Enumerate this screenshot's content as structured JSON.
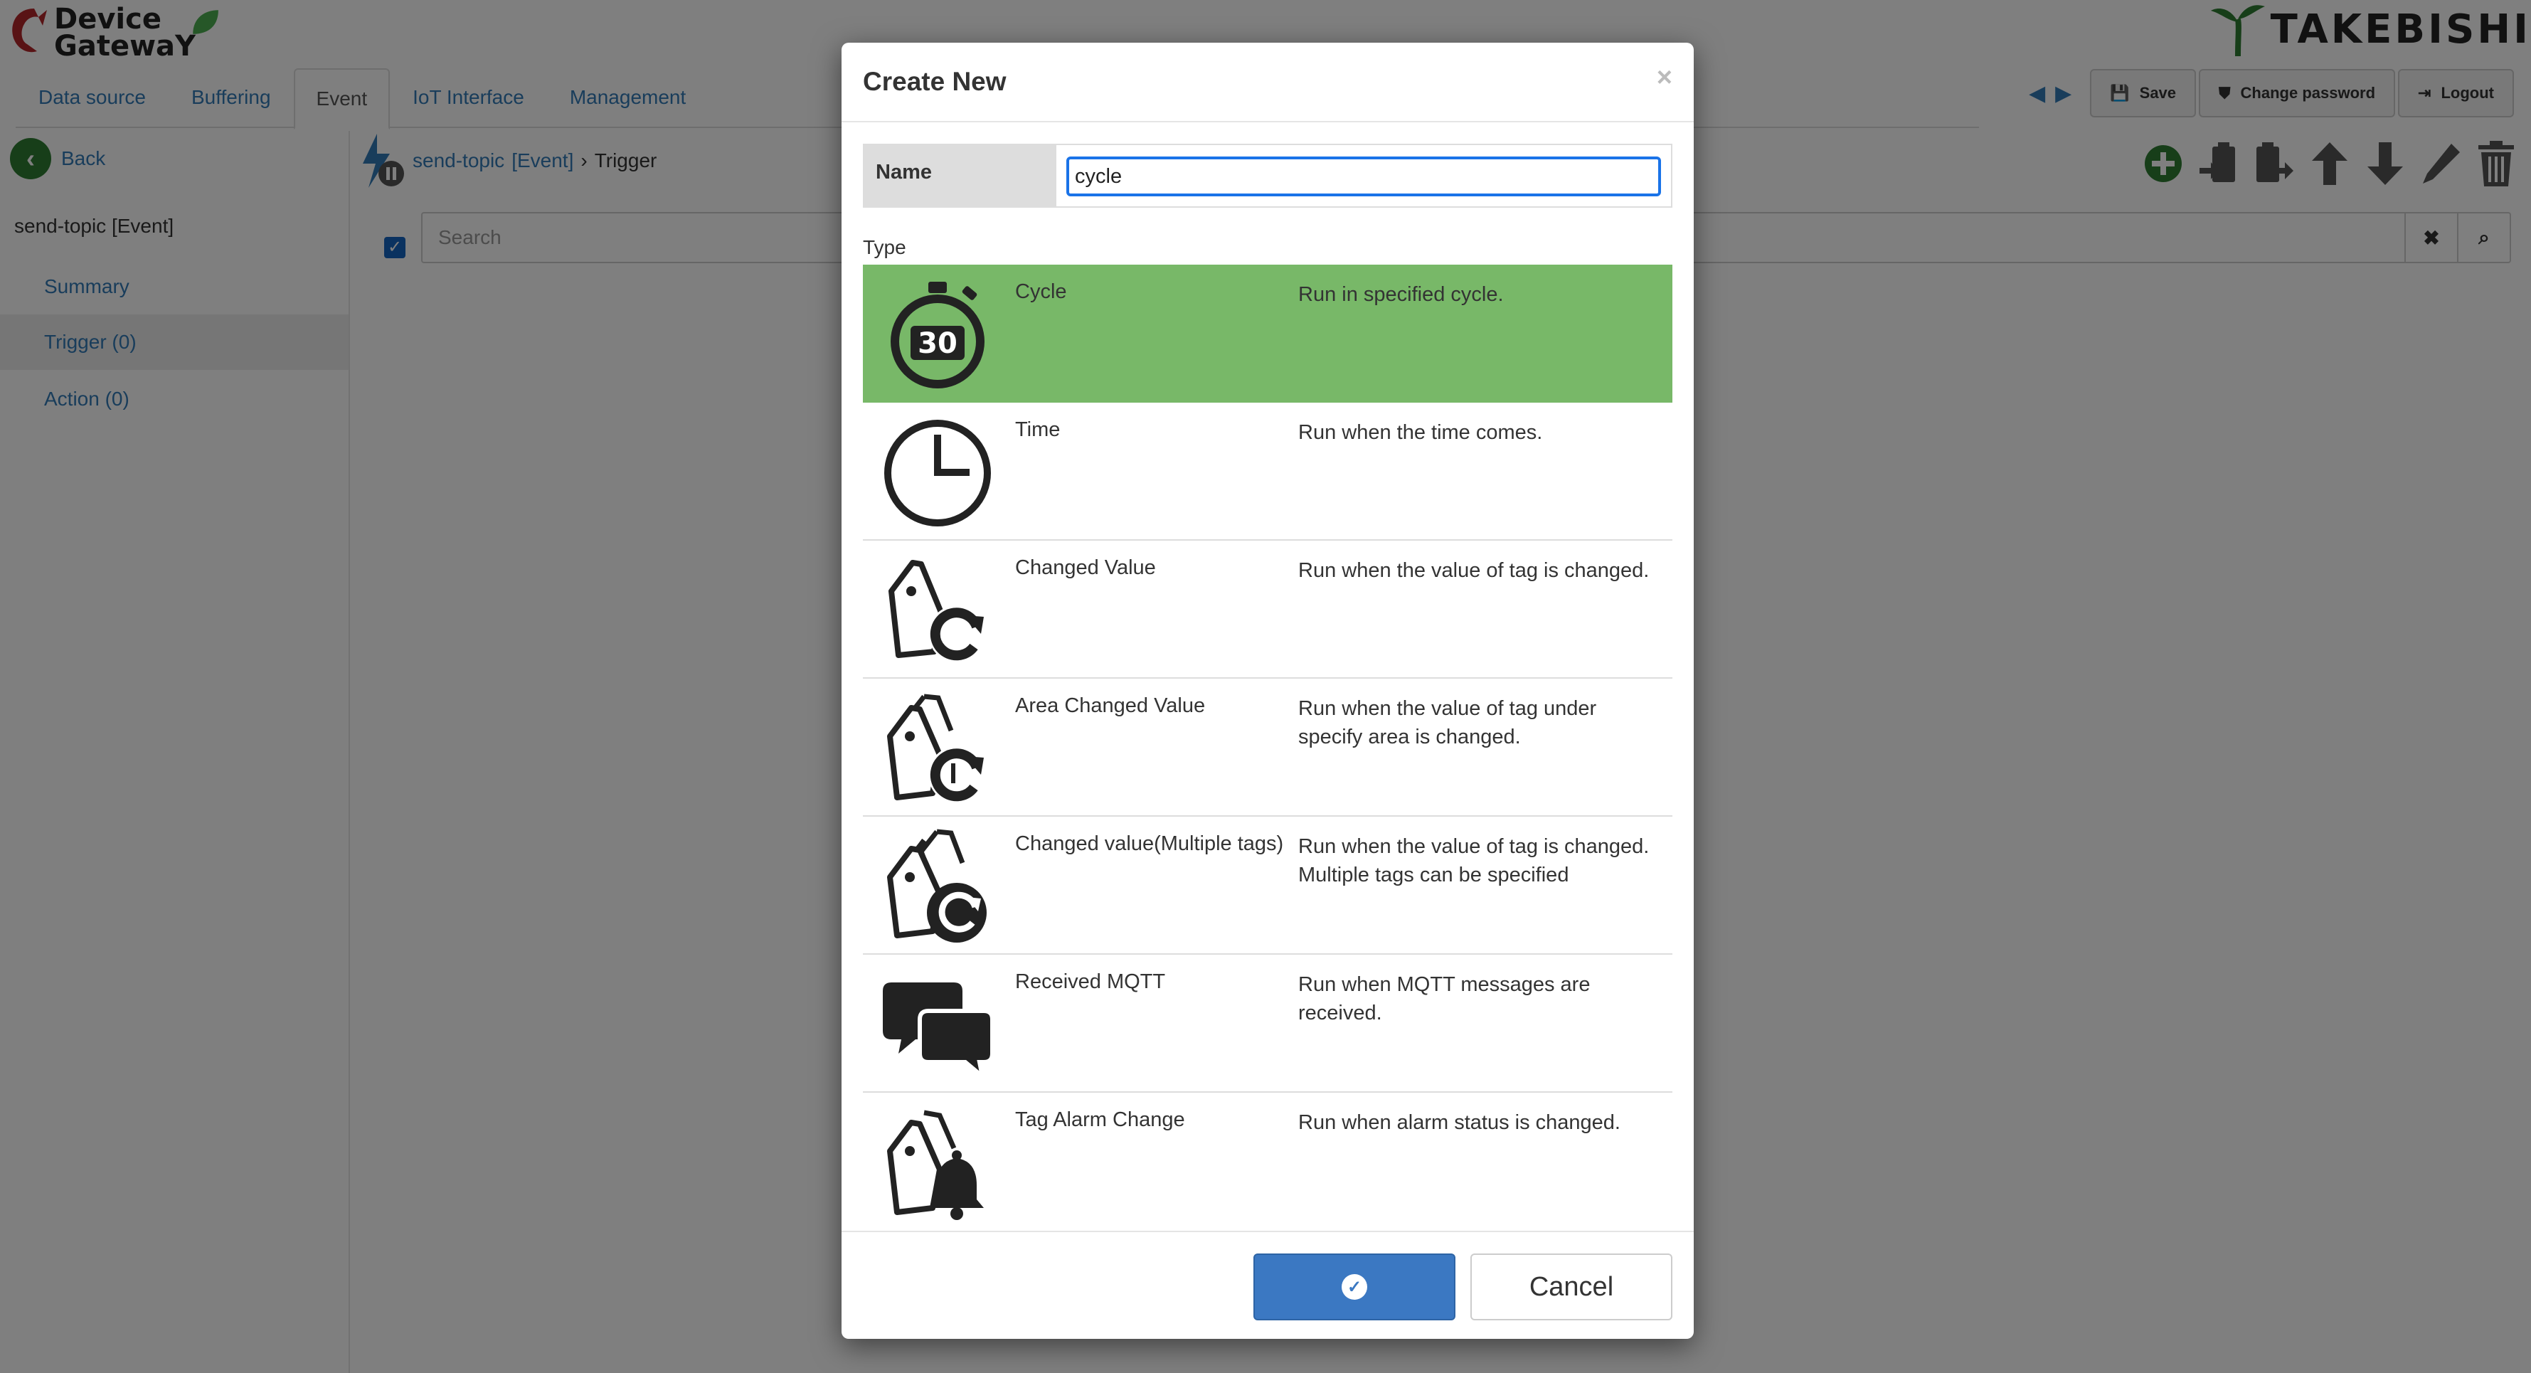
{
  "app": {
    "logo_line1": "Device",
    "logo_line2": "GatewaY",
    "brand": "TAKEBISHI"
  },
  "nav": {
    "tabs": [
      {
        "label": "Data source"
      },
      {
        "label": "Buffering"
      },
      {
        "label": "Event"
      },
      {
        "label": "IoT Interface"
      },
      {
        "label": "Management"
      }
    ],
    "active": "Event"
  },
  "toolbar": {
    "save_label": "Save",
    "change_password_label": "Change password",
    "logout_label": "Logout"
  },
  "sidebar": {
    "back_label": "Back",
    "title": "send-topic  [Event]",
    "items": [
      {
        "label": "Summary"
      },
      {
        "label": "Trigger (0)"
      },
      {
        "label": "Action (0)"
      }
    ]
  },
  "breadcrumb": {
    "item": "send-topic",
    "item_tag": "[Event]",
    "current": "Trigger"
  },
  "search": {
    "placeholder": "Search"
  },
  "modal": {
    "title": "Create New",
    "close_glyph": "×",
    "name_label": "Name",
    "name_value": "cycle",
    "type_label": "Type",
    "types": [
      {
        "name": "Cycle",
        "desc": "Run in specified cycle.",
        "icon": "stopwatch-30-icon",
        "selected": true
      },
      {
        "name": "Time",
        "desc": "Run when the time comes.",
        "icon": "clock-icon",
        "selected": false
      },
      {
        "name": "Changed Value",
        "desc": "Run when the value of tag is changed.",
        "icon": "tag-refresh-icon",
        "selected": false
      },
      {
        "name": "Area Changed Value",
        "desc": "Run when the value of tag under specify area is changed.",
        "icon": "tags-area-refresh-icon",
        "selected": false
      },
      {
        "name": "Changed value(Multiple tags)",
        "desc": "Run when the value of tag is changed. Multiple tags can be specified",
        "icon": "multi-tags-refresh-icon",
        "selected": false
      },
      {
        "name": "Received MQTT",
        "desc": "Run when MQTT messages are received.",
        "icon": "chat-bubbles-icon",
        "selected": false
      },
      {
        "name": "Tag Alarm Change",
        "desc": "Run when alarm status is changed.",
        "icon": "tag-bell-icon",
        "selected": false
      }
    ],
    "stopwatch_number": "30",
    "cancel_label": "Cancel"
  },
  "colors": {
    "selected_row": "#78b868",
    "primary_button": "#3b78c2",
    "link": "#337ab7"
  }
}
